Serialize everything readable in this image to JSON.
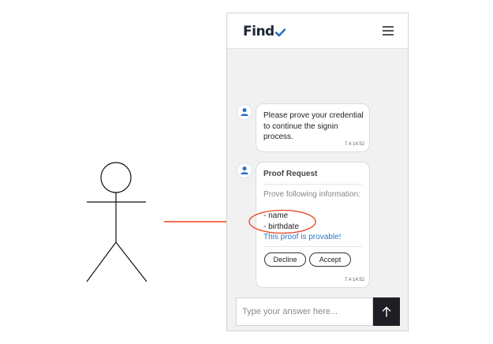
{
  "app": {
    "logo_text": "Find"
  },
  "messages": [
    {
      "text": "Please prove your credential to continue the signin process.",
      "time": "7.4 14:52"
    }
  ],
  "proof_request": {
    "title": "Proof Request",
    "intro": "Prove following information:",
    "attributes": [
      "- name",
      "- birthdate"
    ],
    "status": "This proof is provable!",
    "decline_label": "Decline",
    "accept_label": "Accept",
    "time": "7.4 14:52"
  },
  "composer": {
    "placeholder": "Type your answer here..."
  },
  "icons": {
    "menu": "hamburger-menu-icon",
    "avatar": "user-icon",
    "send": "arrow-up-icon",
    "logo_mark": "checkmark-icon"
  },
  "colors": {
    "accent_blue": "#2a78c8",
    "logo_check": "#2c6fc4",
    "arrow_red": "#e8401c",
    "send_bg": "#1e1e24"
  }
}
